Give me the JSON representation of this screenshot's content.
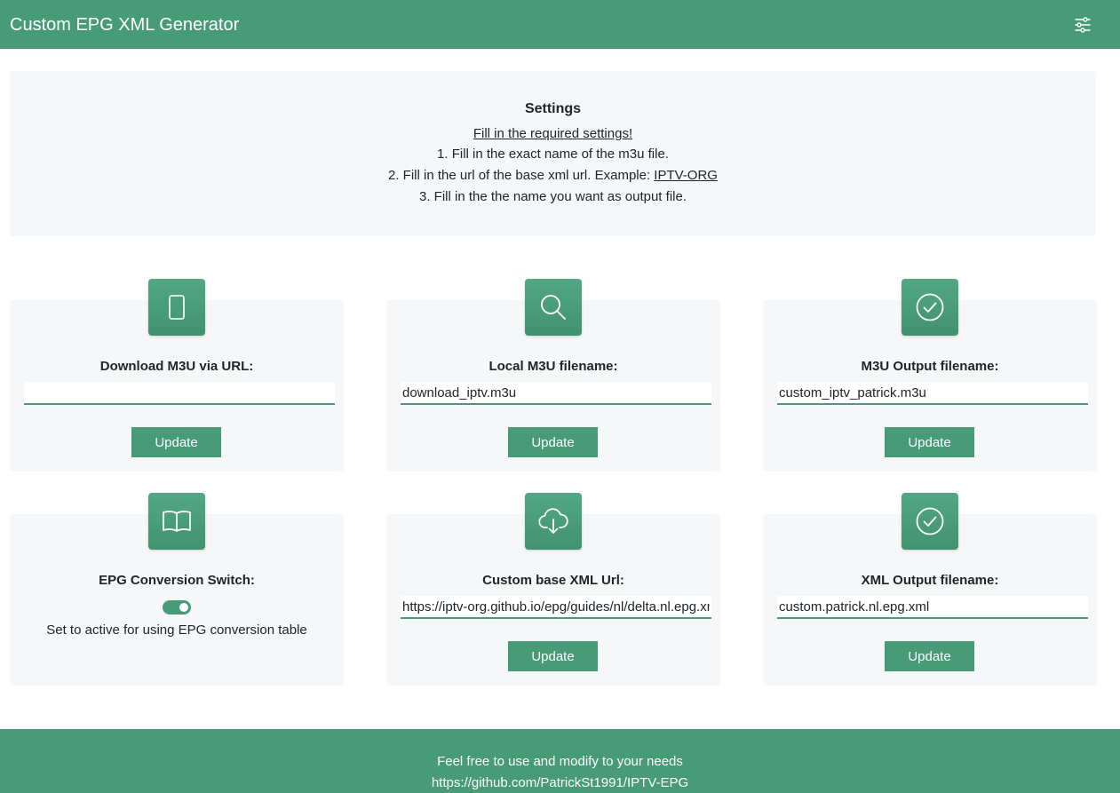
{
  "navbar": {
    "title": "Custom EPG XML Generator",
    "settings_icon": "sliders-icon"
  },
  "settings": {
    "title": "Settings",
    "link_text": "Fill in the required settings!",
    "step1": "1. Fill in the exact name of the m3u file.",
    "step2_text": "2. Fill in the url of the base xml url. Example: ",
    "step2_link": "IPTV-ORG",
    "step3": "3. Fill in the the name you want as output file."
  },
  "cards": {
    "download_m3u": {
      "icon": "tablet-icon",
      "title": "Download M3U via URL:",
      "value": "",
      "button": "Update"
    },
    "local_m3u": {
      "icon": "search-icon",
      "title": "Local M3U filename:",
      "value": "download_iptv.m3u",
      "button": "Update"
    },
    "m3u_output": {
      "icon": "check-circle-icon",
      "title": "M3U Output filename:",
      "value": "custom_iptv_patrick.m3u",
      "button": "Update"
    },
    "epg_switch": {
      "icon": "book-icon",
      "title": "EPG Conversion Switch:",
      "active": true,
      "description": "Set to active for using EPG conversion table"
    },
    "base_xml": {
      "icon": "cloud-download-icon",
      "title": "Custom base XML Url:",
      "value": "https://iptv-org.github.io/epg/guides/nl/delta.nl.epg.xml",
      "button": "Update"
    },
    "xml_output": {
      "icon": "check-circle-icon",
      "title": "XML Output filename:",
      "value": "custom.patrick.nl.epg.xml",
      "button": "Update"
    }
  },
  "footer": {
    "line1": "Feel free to use and modify to your needs",
    "line2": "https://github.com/PatrickSt1991/IPTV-EPG"
  },
  "colors": {
    "primary": "#479b77",
    "panel": "#f6f7f9",
    "text": "#212529"
  }
}
